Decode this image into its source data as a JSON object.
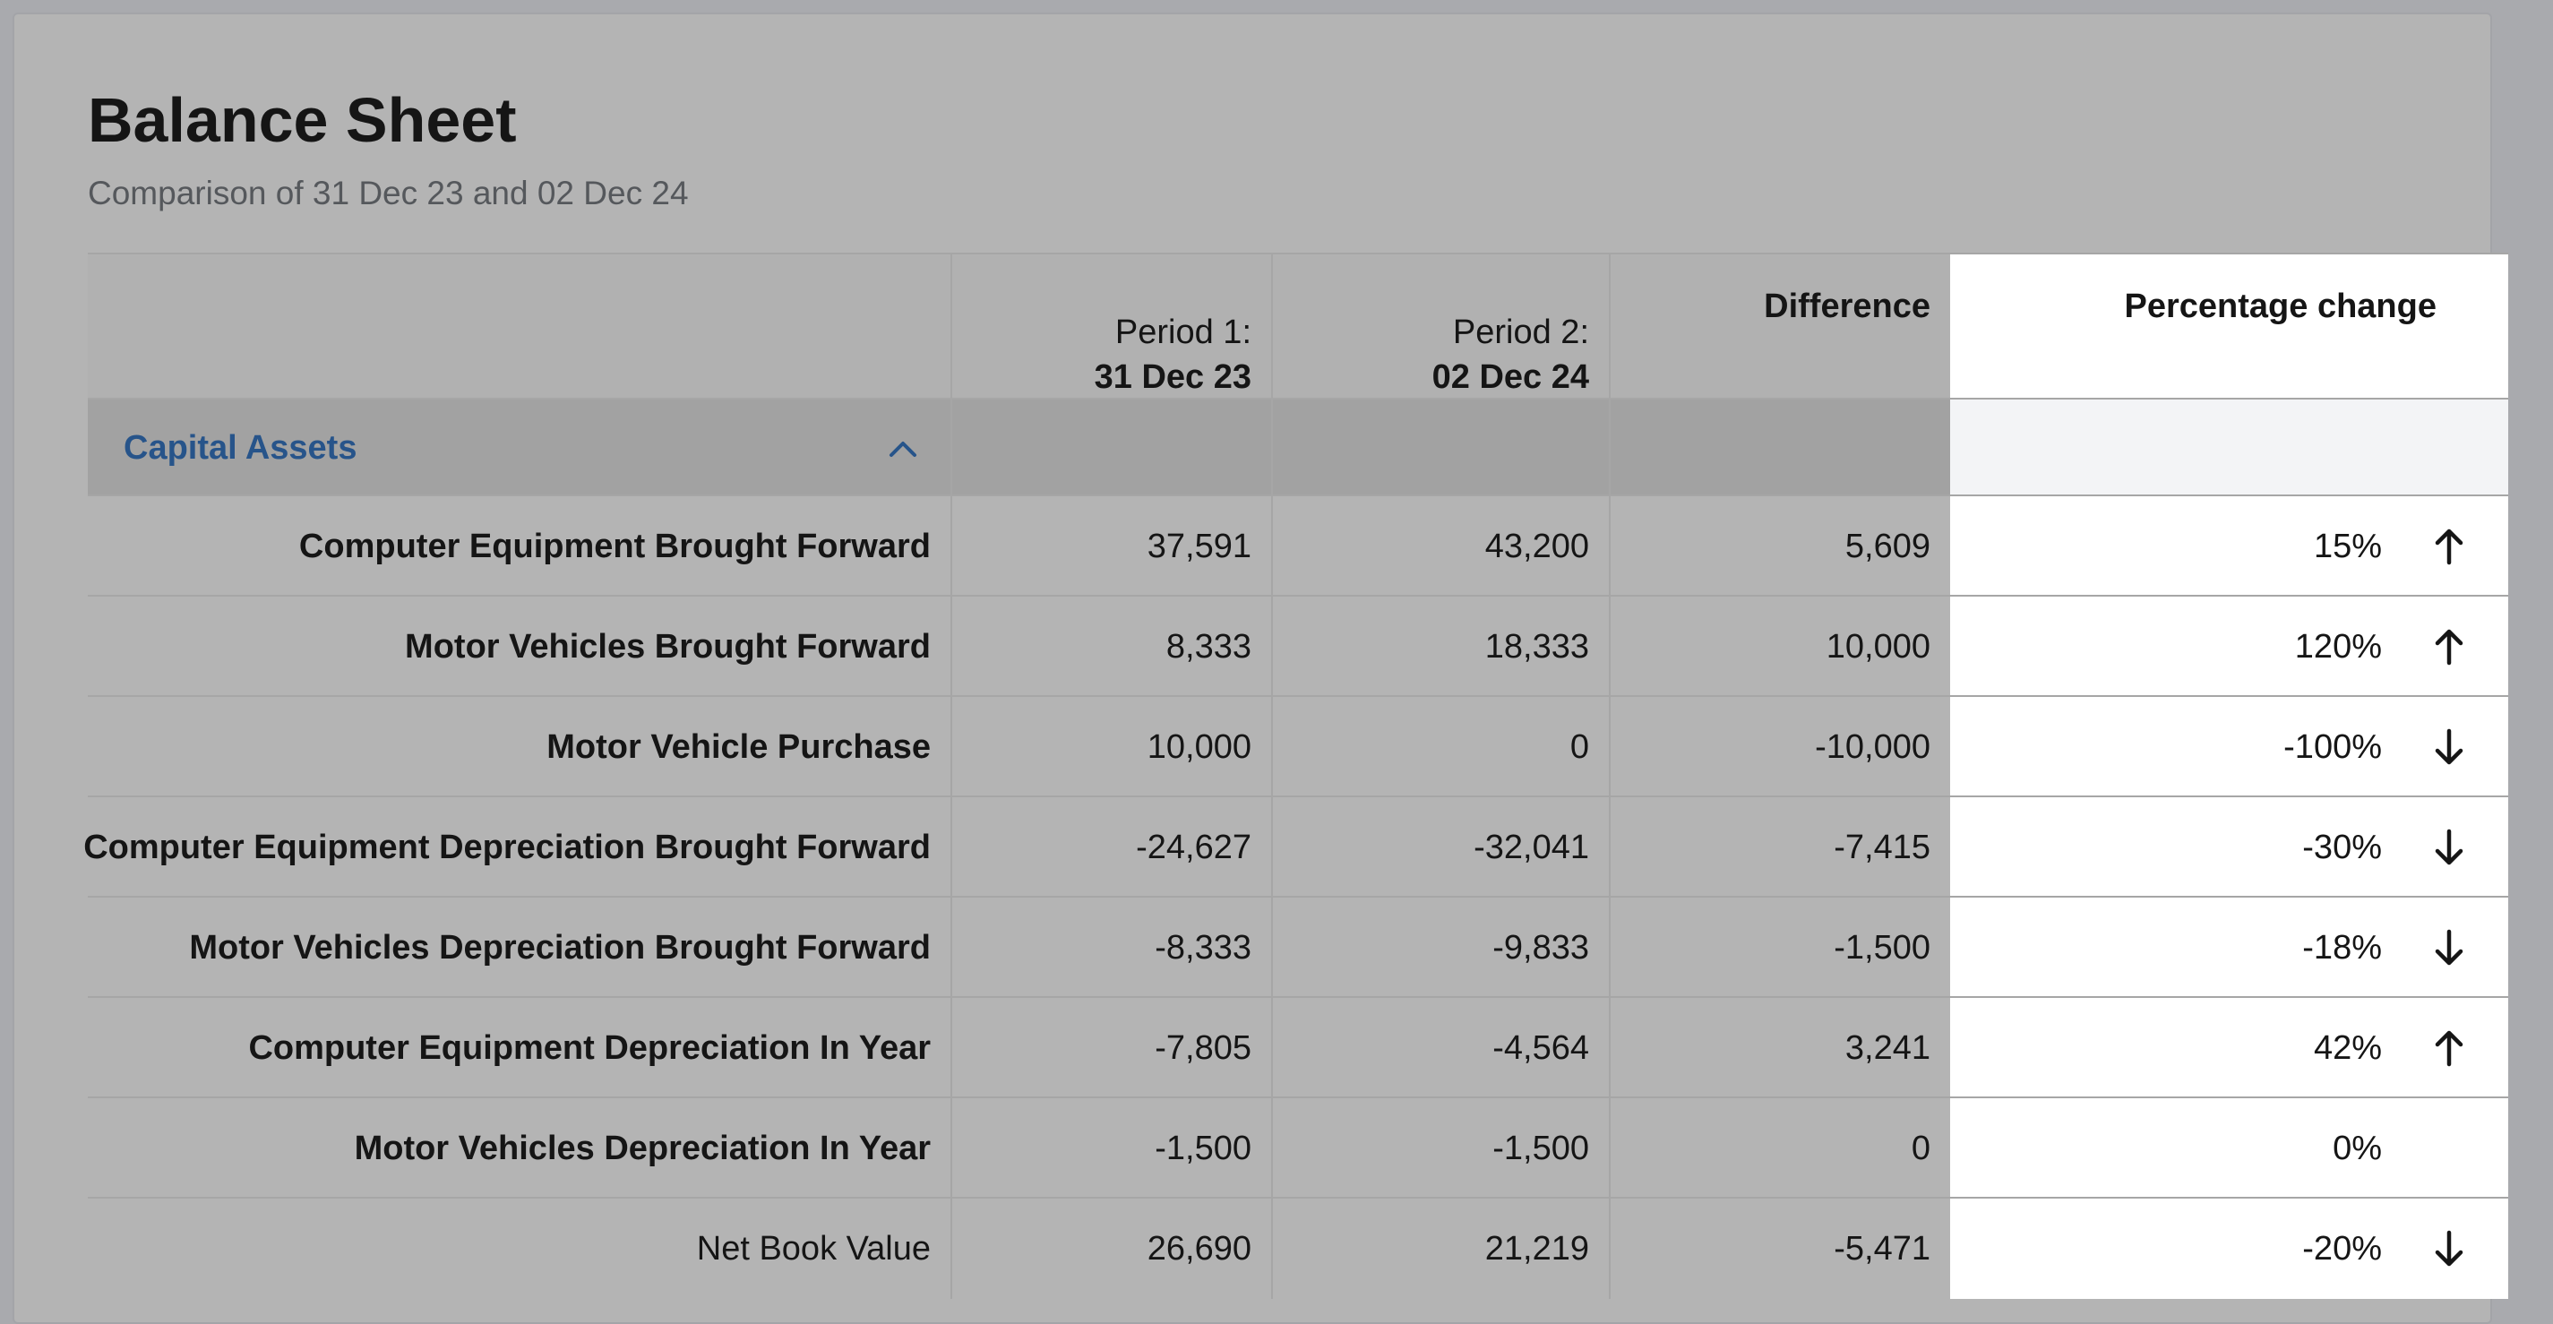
{
  "header": {
    "title": "Balance Sheet",
    "subtitle": "Comparison of 31 Dec 23 and 02 Dec 24"
  },
  "columns": {
    "period1_label": "Period 1:",
    "period1_date": "31 Dec 23",
    "period2_label": "Period 2:",
    "period2_date": "02 Dec 24",
    "difference": "Difference",
    "percentage": "Percentage change"
  },
  "section": {
    "label": "Capital Assets",
    "expanded": true,
    "icon": "chevron-up-icon",
    "accent_color": "#27548a"
  },
  "rows": [
    {
      "label": "Computer Equipment Brought Forward",
      "p1": "37,591",
      "p2": "43,200",
      "diff": "5,609",
      "pct": "15%",
      "trend": "up"
    },
    {
      "label": "Motor Vehicles Brought Forward",
      "p1": "8,333",
      "p2": "18,333",
      "diff": "10,000",
      "pct": "120%",
      "trend": "up"
    },
    {
      "label": "Motor Vehicle Purchase",
      "p1": "10,000",
      "p2": "0",
      "diff": "-10,000",
      "pct": "-100%",
      "trend": "down"
    },
    {
      "label": "Computer Equipment Depreciation Brought Forward",
      "p1": "-24,627",
      "p2": "-32,041",
      "diff": "-7,415",
      "pct": "-30%",
      "trend": "down"
    },
    {
      "label": "Motor Vehicles Depreciation Brought Forward",
      "p1": "-8,333",
      "p2": "-9,833",
      "diff": "-1,500",
      "pct": "-18%",
      "trend": "down"
    },
    {
      "label": "Computer Equipment Depreciation In Year",
      "p1": "-7,805",
      "p2": "-4,564",
      "diff": "3,241",
      "pct": "42%",
      "trend": "up"
    },
    {
      "label": "Motor Vehicles Depreciation In Year",
      "p1": "-1,500",
      "p2": "-1,500",
      "diff": "0",
      "pct": "0%",
      "trend": "none"
    }
  ],
  "total": {
    "label": "Net Book Value",
    "p1": "26,690",
    "p2": "21,219",
    "diff": "-5,471",
    "pct": "-20%",
    "trend": "down"
  }
}
